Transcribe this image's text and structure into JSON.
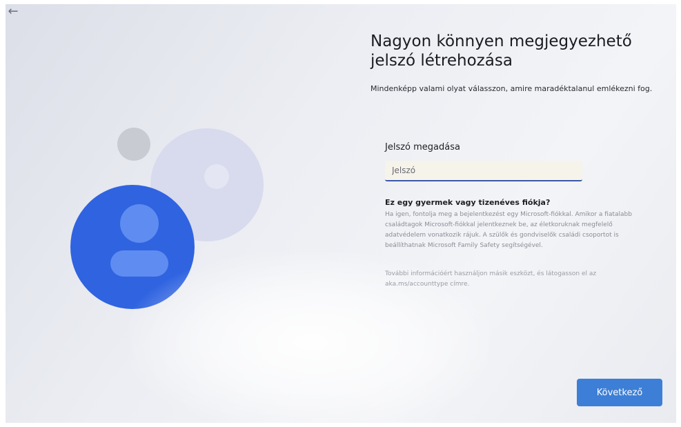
{
  "nav": {
    "back_icon": "back-arrow-icon",
    "back_glyph": "←"
  },
  "header": {
    "title": "Nagyon könnyen megjegyezhető jelszó létrehozása",
    "subtitle": "Mindenképp valami olyat válasszon, amire maradéktalanul emlékezni fog."
  },
  "password": {
    "label": "Jelszó megadása",
    "placeholder": "Jelszó",
    "value": ""
  },
  "child_account": {
    "title": "Ez egy gyermek vagy tizenéves fiókja?",
    "body": "Ha igen, fontolja meg a bejelentkezést egy Microsoft-fiókkal. Amikor a fiatalabb családtagok Microsoft-fiókkal jelentkeznek be, az életkoruknak megfelelő adatvédelem vonatkozik rájuk. A szülők és gondviselők családi csoportot is beállíthatnak Microsoft Family Safety segítségével.",
    "more_info": "További információért használjon másik eszközt, és látogasson el az aka.ms/accounttype címre."
  },
  "footer": {
    "next_label": "Következő"
  },
  "colors": {
    "accent": "#3d7fd6",
    "illustration_blue": "#2f63e0",
    "illustration_lavender": "#cfd2ea",
    "illustration_gray": "#c9cbd3"
  }
}
